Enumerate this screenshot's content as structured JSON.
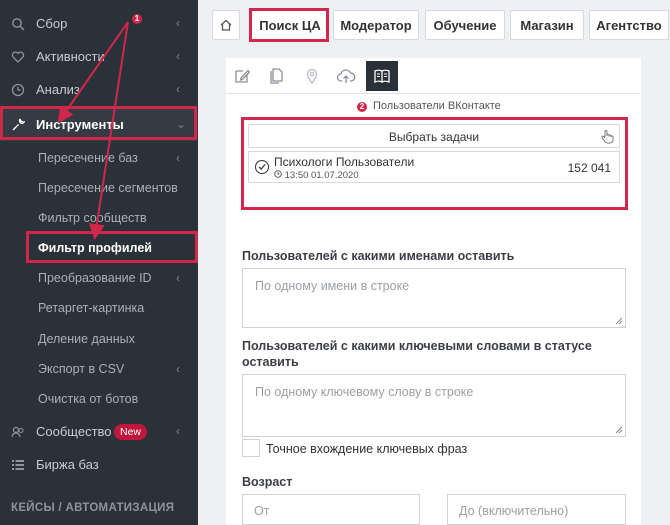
{
  "sidebar": {
    "items": [
      {
        "label": "Сбор",
        "icon": "search-icon"
      },
      {
        "label": "Активности",
        "icon": "heart-icon"
      },
      {
        "label": "Анализ",
        "icon": "clock-icon"
      },
      {
        "label": "Инструменты",
        "icon": "wrench-icon"
      }
    ],
    "subitems": [
      "Пересечение баз",
      "Пересечение сегментов",
      "Фильтр сообществ",
      "Фильтр профилей",
      "Преобразование ID",
      "Ретаргет-картинка",
      "Деление данных",
      "Экспорт в CSV",
      "Очистка от ботов"
    ],
    "community": {
      "label": "Сообщество",
      "badge": "New",
      "icon": "users-icon"
    },
    "exchange": {
      "label": "Биржа баз",
      "icon": "list-icon"
    },
    "section_title": "КЕЙСЫ / АВТОМАТИЗАЦИЯ"
  },
  "annotations": {
    "marker1": "1",
    "marker2": "2"
  },
  "tabs": [
    "Поиск ЦА",
    "Модератор",
    "Обучение",
    "Магазин",
    "Агентство"
  ],
  "panel": {
    "caption": "Пользователи ВКонтакте",
    "select_label": "Выбрать задачи",
    "task": {
      "name": "Психологи Пользователи",
      "time": "13:50 01.07.2020",
      "count": "152 041"
    },
    "names_label": "Пользователей с какими именами оставить",
    "names_placeholder": "По одному имени в строке",
    "keywords_label_1": "Пользователей с какими ключевыми словами в статусе",
    "keywords_label_2": "оставить",
    "keywords_placeholder": "По одному ключевому слову в строке",
    "exact_label": "Точное вхождение ключевых фраз",
    "age_label": "Возраст",
    "age_from": "От",
    "age_to": "До (включительно)"
  },
  "colors": {
    "accent": "#d1274b",
    "sidebar_bg": "#2b3138"
  }
}
